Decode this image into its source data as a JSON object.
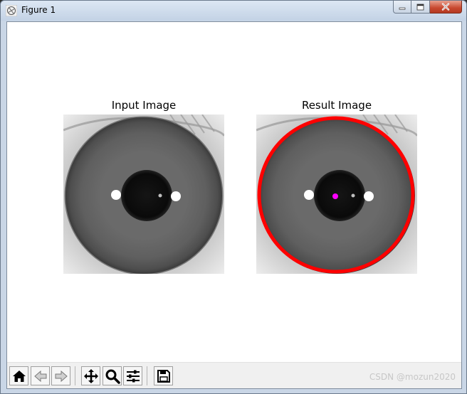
{
  "window": {
    "title": "Figure 1"
  },
  "figure": {
    "left_axes": {
      "title": "Input Image"
    },
    "right_axes": {
      "title": "Result Image"
    },
    "overlay": {
      "circle_color": "#ff0000",
      "center_color": "#ff00ff"
    }
  },
  "toolbar": {
    "buttons": [
      "home-icon",
      "back-icon",
      "forward-icon",
      "pan-icon",
      "zoom-icon",
      "configure-subplots-icon",
      "save-icon"
    ]
  },
  "watermark": "CSDN @mozun2020"
}
